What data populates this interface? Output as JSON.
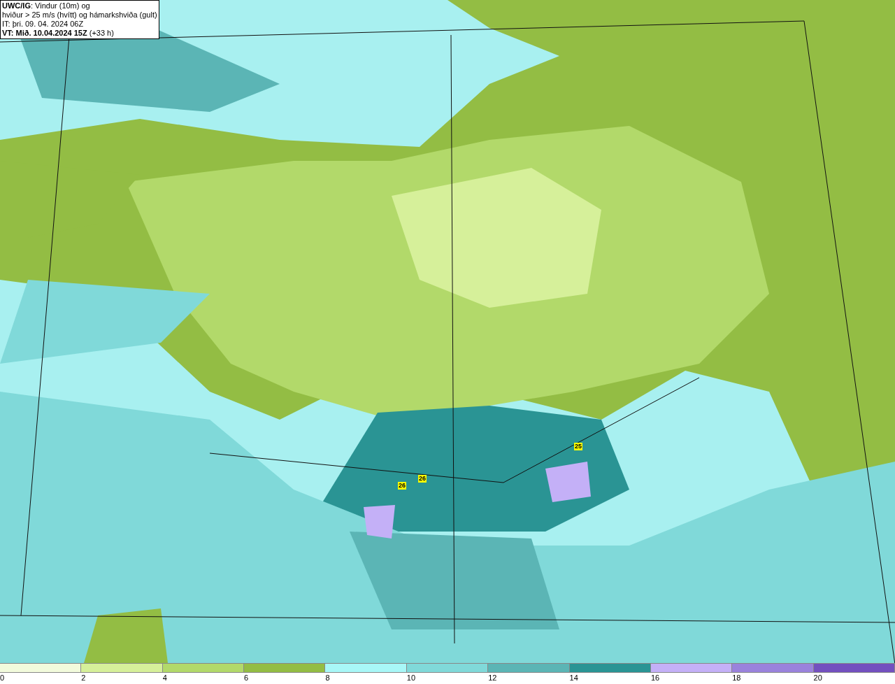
{
  "title_box": {
    "lines": [
      "**UWC/IG**: Vindur (10m) og",
      "hviður > 25 m/s (hvítt) og hámarkshviða (gult)",
      "IT: þri. 09. 04. 2024 06Z",
      "**VT: Mið. 10.04.2024 15Z** (+33 h)"
    ]
  },
  "map": {
    "gust_labels": [
      "26",
      "26",
      "25"
    ]
  },
  "legend": {
    "segments": [
      {
        "color": "#f2fbdc"
      },
      {
        "color": "#d6f09a"
      },
      {
        "color": "#b2d96a"
      },
      {
        "color": "#93bd44"
      },
      {
        "color": "#a8f7f7"
      },
      {
        "color": "#80d9d9"
      },
      {
        "color": "#5bb5b5"
      },
      {
        "color": "#2a9494"
      },
      {
        "color": "#c4b0f7"
      },
      {
        "color": "#9a82dc"
      },
      {
        "color": "#7350bf"
      }
    ],
    "ticks": [
      "0",
      "2",
      "4",
      "6",
      "8",
      "10",
      "12",
      "14",
      "16",
      "18",
      "20"
    ]
  }
}
